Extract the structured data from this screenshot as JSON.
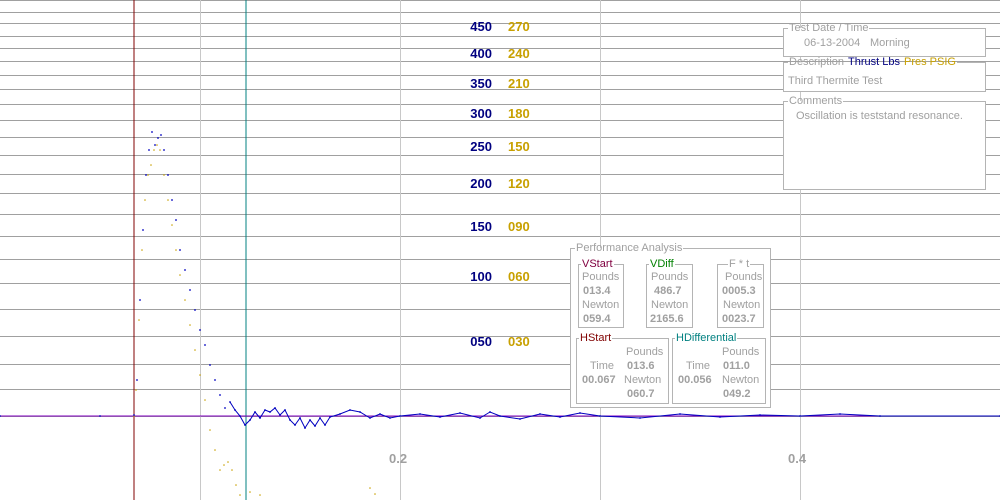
{
  "left_axis": {
    "color": "#000080",
    "ticks": [
      "450",
      "400",
      "350",
      "300",
      "250",
      "200",
      "150",
      "100",
      "050"
    ]
  },
  "right_axis": {
    "color": "#c8a000",
    "ticks": [
      "270",
      "240",
      "210",
      "180",
      "150",
      "120",
      "090",
      "060",
      "030"
    ]
  },
  "x_axis": {
    "ticks": [
      "0.2",
      "0.4"
    ]
  },
  "info": {
    "date_legend": "Test Date / Time",
    "date": "06-13-2004",
    "time": "Morning",
    "desc_legend": "Description",
    "legend_thrust": "Thrust Lbs",
    "legend_pres": "Pres PSIG",
    "description": "Third Thermite Test",
    "comments_legend": "Comments",
    "comments": "Oscillation is teststand resonance."
  },
  "perf": {
    "title": "Performance Analysis",
    "vstart": {
      "label": "VStart",
      "pounds_label": "Pounds",
      "pounds": "013.4",
      "newton_label": "Newton",
      "newton": "059.4"
    },
    "vdiff": {
      "label": "VDiff",
      "pounds_label": "Pounds",
      "pounds": "486.7",
      "newton_label": "Newton",
      "newton": "2165.6"
    },
    "ft": {
      "label": "F * t",
      "pounds_label": "Pounds",
      "pounds": "0005.3",
      "newton_label": "Newton",
      "newton": "0023.7"
    },
    "hstart": {
      "label": "HStart",
      "time_label": "Time",
      "time": "00.067",
      "pounds_label": "Pounds",
      "pounds": "013.6",
      "newton_label": "Newton",
      "newton": "060.7"
    },
    "hdiff": {
      "label": "HDifferential",
      "time_label": "Time",
      "time": "00.056",
      "pounds_label": "Pounds",
      "pounds": "011.0",
      "newton_label": "Newton",
      "newton": "049.2"
    }
  },
  "colors": {
    "thrust": "#0000c0",
    "pressure": "#c8a000",
    "cursor_red": "#800000",
    "cursor_teal": "#008080",
    "baseline": "#8000c0"
  }
}
